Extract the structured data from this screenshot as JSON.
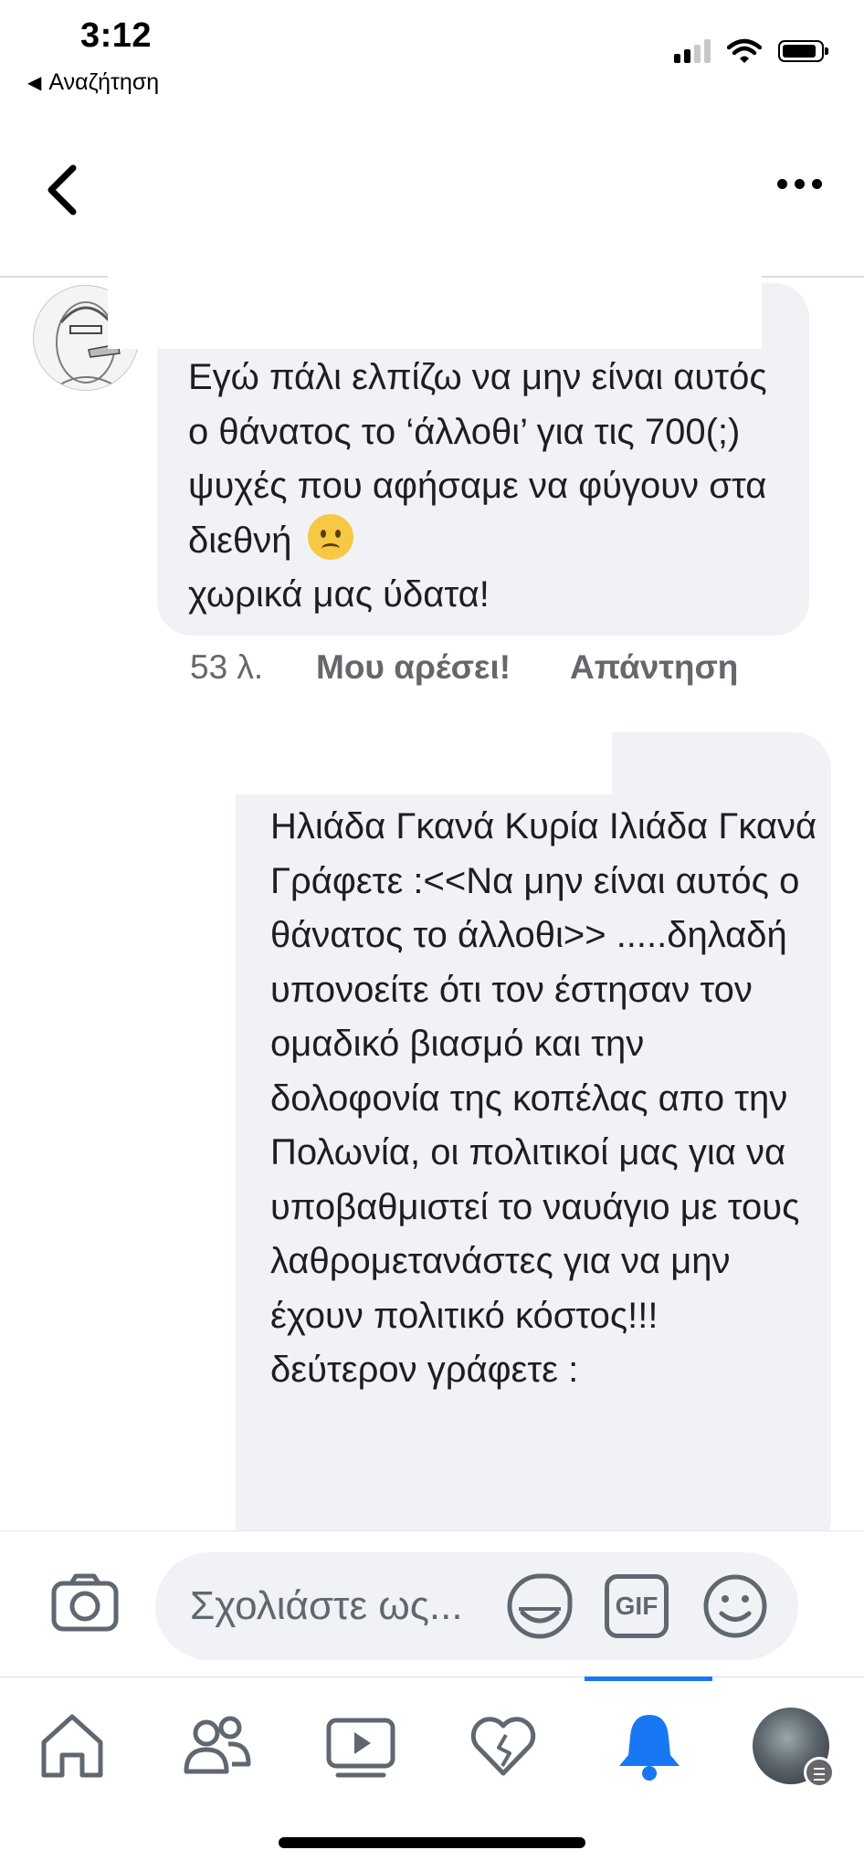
{
  "status_bar": {
    "time": "3:12",
    "back_app": "Αναζήτηση",
    "icons": [
      "cellular-signal-icon",
      "wifi-icon",
      "battery-icon"
    ]
  },
  "header": {
    "icons": [
      "back-chevron-icon",
      "more-dots-icon"
    ]
  },
  "comments": [
    {
      "text": "Εγώ πάλι ελπίζω να μην είναι αυτός ο θάνατος το ‘άλλοθι’ για τις 700(;) ψυχές που αφήσαμε να φύγουν στα διεθνή",
      "text_end": "χωρικά μας ύδατα!",
      "emoji": "worried-face-emoji",
      "time": "53 λ.",
      "like_label": "Μου αρέσει!",
      "reply_label": "Απάντηση"
    },
    {
      "text": "Ηλιάδα Γκανά Κυρία Ιλιάδα Γκανά Γράφετε :<<Να μην είναι αυτός ο θάνατος το άλλοθι>> .....δηλαδή υπονοείτε ότι τον έστησαν τον ομαδικό βιασμό και την δολοφονία  της κοπέλας απο την Πολωνία,   οι πολιτικοί μας για να υποβαθμιστεί το ναυάγιο με τους λαθρομετανάστες για να μην έχουν πολιτικό κόστος!!!\nδεύτερον  γράφετε :"
    }
  ],
  "composer": {
    "placeholder": "Σχολιάστε ως...",
    "gif_label": "GIF",
    "icons": [
      "camera-icon",
      "sticker-icon",
      "gif-icon",
      "emoji-icon"
    ]
  },
  "bottom_nav": {
    "items": [
      "home",
      "friends",
      "watch",
      "dating",
      "notifications",
      "menu-profile"
    ],
    "active": "notifications",
    "accent_color": "#1877f2"
  }
}
